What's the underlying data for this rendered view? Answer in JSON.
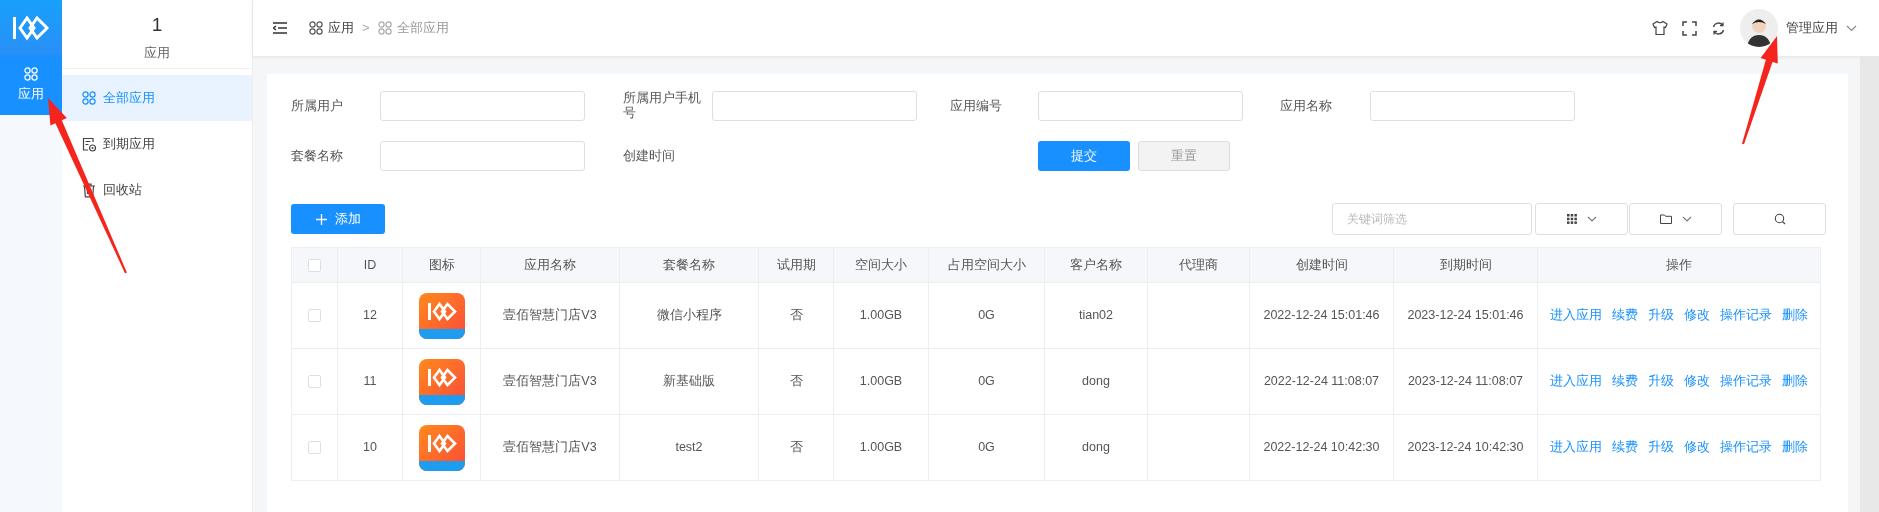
{
  "rail": {
    "items": [
      {
        "label": "应用",
        "selected": true
      }
    ]
  },
  "side": {
    "count": "1",
    "title": "应用",
    "items": [
      {
        "label": "全部应用",
        "kind": "apps",
        "selected": true
      },
      {
        "label": "到期应用",
        "kind": "expired",
        "selected": false
      },
      {
        "label": "回收站",
        "kind": "trash",
        "selected": false
      }
    ]
  },
  "breadcrumb": [
    {
      "label": "应用",
      "current": false
    },
    {
      "label": "全部应用",
      "current": true
    }
  ],
  "breadcrumb_separator": ">",
  "user": {
    "name": "管理应用"
  },
  "filters": [
    {
      "label": "所属用户",
      "kind": "input"
    },
    {
      "label": "所属用户手机号",
      "kind": "input"
    },
    {
      "label": "应用编号",
      "kind": "input"
    },
    {
      "label": "应用名称",
      "kind": "input"
    },
    {
      "label": "套餐名称",
      "kind": "input"
    },
    {
      "label": "创建时间",
      "kind": "label_only"
    }
  ],
  "submit_button": "提交",
  "reset_button": "重置",
  "add_button": "添加",
  "keyword_search": {
    "placeholder": "关键词筛选"
  },
  "table": {
    "all_checked": false,
    "columns": [
      "ID",
      "图标",
      "应用名称",
      "套餐名称",
      "试用期",
      "空间大小",
      "占用空间大小",
      "客户名称",
      "代理商",
      "创建时间",
      "到期时间",
      "操作"
    ],
    "rows": [
      {
        "checked": false,
        "id": "12",
        "app_name": "壹佰智慧门店V3",
        "plan": "微信小程序",
        "trial": "否",
        "space": "1.00GB",
        "used": "0G",
        "customer": "tian02",
        "created": "2022-12-24 15:01:46",
        "expires": "2023-12-24 15:01:46",
        "actions": [
          "进入应用",
          "续费",
          "升级",
          "修改",
          "操作记录",
          "删除"
        ]
      },
      {
        "checked": false,
        "id": "11",
        "app_name": "壹佰智慧门店V3",
        "plan": "新基础版",
        "trial": "否",
        "space": "1.00GB",
        "used": "0G",
        "customer": "dong",
        "created": "2022-12-24 11:08:07",
        "expires": "2023-12-24 11:08:07",
        "actions": [
          "进入应用",
          "续费",
          "升级",
          "修改",
          "操作记录",
          "删除"
        ]
      },
      {
        "checked": false,
        "id": "10",
        "app_name": "壹佰智慧门店V3",
        "plan": "test2",
        "trial": "否",
        "space": "1.00GB",
        "used": "0G",
        "customer": "dong",
        "created": "2022-12-24 10:42:30",
        "expires": "2023-12-24 10:42:30",
        "actions": [
          "进入应用",
          "续费",
          "升级",
          "修改",
          "操作记录",
          "删除"
        ]
      }
    ]
  }
}
